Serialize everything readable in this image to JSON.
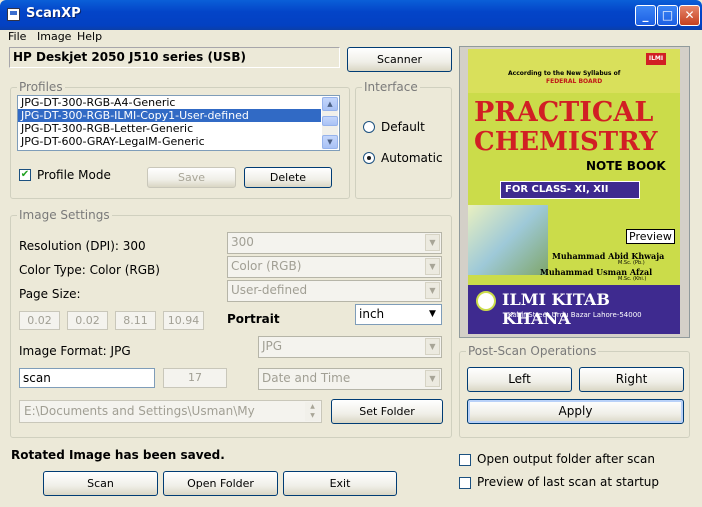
{
  "window": {
    "title": "ScanXP",
    "min": "_",
    "max": "□",
    "close": "✕"
  },
  "menu": [
    "File",
    "Image",
    "Help"
  ],
  "scanner": {
    "device": "HP Deskjet 2050 J510 series (USB)",
    "button": "Scanner"
  },
  "profiles": {
    "legend": "Profiles",
    "items": [
      "JPG-DT-300-RGB-A4-Generic",
      "JPG-DT-300-RGB-ILMI-Copy1-User-defined",
      "JPG-DT-300-RGB-Letter-Generic",
      "JPG-DT-600-GRAY-LegalM-Generic"
    ],
    "selected_index": 1,
    "profile_mode_label": "Profile Mode",
    "profile_mode_checked": true,
    "save_label": "Save",
    "delete_label": "Delete"
  },
  "interface": {
    "legend": "Interface",
    "default_label": "Default",
    "automatic_label": "Automatic",
    "selected": "Automatic"
  },
  "image_settings": {
    "legend": "Image Settings",
    "resolution_label": "Resolution (DPI): 300",
    "resolution_value": "300",
    "color_type_label": "Color Type: Color (RGB)",
    "color_type_value": "Color (RGB)",
    "page_size_label": "Page Size:",
    "page_size_value": "User-defined",
    "margins": [
      "0.02",
      "0.02",
      "8.11",
      "10.94"
    ],
    "orientation": "Portrait",
    "unit": "inch",
    "format_label": "Image Format: JPG",
    "format_value": "JPG",
    "filename": "scan",
    "counter": "17",
    "naming": "Date and Time",
    "folder": "E:\\Documents and Settings\\Usman\\My",
    "set_folder_label": "Set Folder"
  },
  "preview": {
    "syllabus": "According to the New Syllabus of",
    "board": "FEDERAL BOARD",
    "badge": "ILMI",
    "title1": "PRACTICAL",
    "title2": "CHEMISTRY",
    "subtitle": "NOTE BOOK",
    "class_label": "FOR CLASS- XI, XII",
    "preview_tag": "Preview",
    "author1": "Muhammad Abid Khwaja",
    "author1_deg": "M.Sc. (Pb.)",
    "author2": "Muhammad Usman Afzal",
    "author2_deg": "M.Sc. (Khi.)",
    "publisher": "ILMI KITAB KHANA",
    "address": "Kabir Street Urdu Bazar Lahore-54000"
  },
  "post_scan": {
    "legend": "Post-Scan Operations",
    "left": "Left",
    "right": "Right",
    "apply": "Apply"
  },
  "status": "Rotated Image has been saved.",
  "footer": {
    "scan": "Scan",
    "open_folder": "Open Folder",
    "exit": "Exit"
  },
  "options": {
    "open_output_label": "Open output folder after scan",
    "open_output_checked": false,
    "preview_last_label": "Preview of last scan at startup",
    "preview_last_checked": false
  },
  "colors": {
    "titlebar": "#0344c8",
    "selection": "#316ac5",
    "cover_bg": "#cbdc4a",
    "cover_title": "#d11f24",
    "cover_band": "#3e2a8f"
  }
}
